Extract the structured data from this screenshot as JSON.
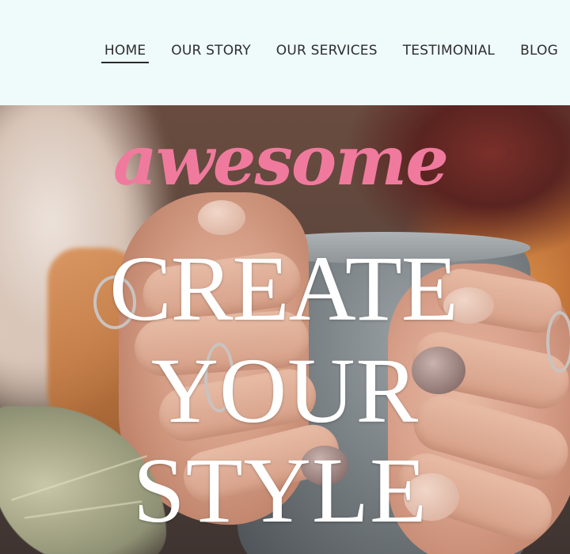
{
  "nav": {
    "items": [
      {
        "label": "HOME",
        "active": true
      },
      {
        "label": "OUR STORY",
        "active": false
      },
      {
        "label": "OUR SERVICES",
        "active": false
      },
      {
        "label": "TESTIMONIAL",
        "active": false
      },
      {
        "label": "BLOG",
        "active": false
      }
    ]
  },
  "hero": {
    "script_word": "awesome",
    "headline_lines": [
      "CREATE",
      "YOUR",
      "STYLE"
    ],
    "colors": {
      "script": "#f07a9d",
      "headline": "#ffffff",
      "header_background": "#effafa"
    }
  }
}
